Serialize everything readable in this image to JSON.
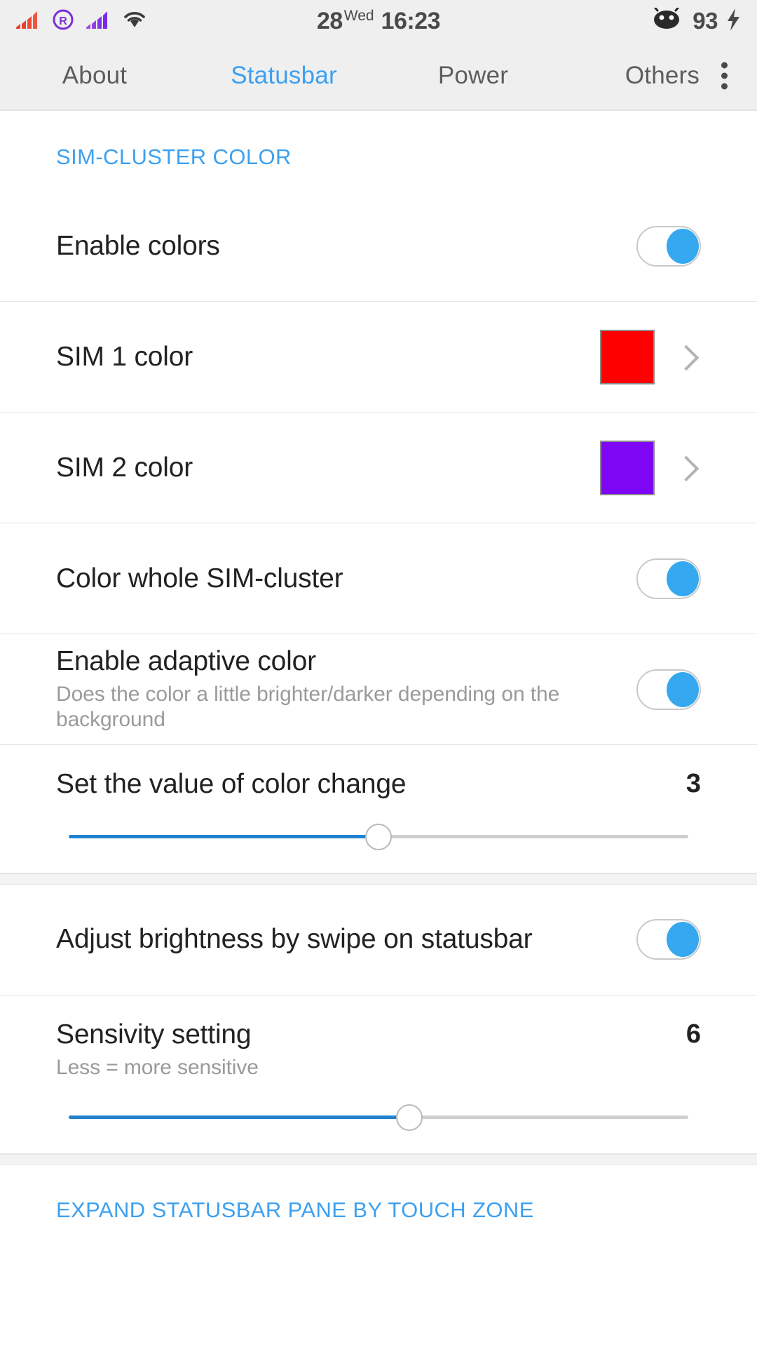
{
  "statusbar": {
    "icons": [
      "signal-bars-red-icon",
      "roaming-r-icon",
      "signal-bars-purple-icon",
      "wifi-icon"
    ],
    "date": "28",
    "day_of_week": "Wed",
    "time": "16:23",
    "android_head_icon": "android-head-icon",
    "battery_level": "93",
    "charging_icon": "charging-bolt-icon",
    "bg_color": "#efefef"
  },
  "tabs": [
    {
      "label": "About",
      "active": false
    },
    {
      "label": "Statusbar",
      "active": true
    },
    {
      "label": "Power",
      "active": false
    },
    {
      "label": "Others",
      "active": false
    }
  ],
  "overflow_menu_icon": "overflow-menu-icon",
  "accent_color": "#3da0f0",
  "sections": [
    {
      "header": "SIM-CLUSTER COLOR",
      "rows": [
        {
          "type": "toggle",
          "title": "Enable colors",
          "subtitle": "",
          "value": "on"
        },
        {
          "type": "color",
          "title": "SIM 1 color",
          "subtitle": "",
          "color": "#ff0000",
          "chevron": "chevron-right-icon"
        },
        {
          "type": "color",
          "title": "SIM 2 color",
          "subtitle": "",
          "color": "#7f06f5",
          "chevron": "chevron-right-icon"
        },
        {
          "type": "toggle",
          "title": "Color whole SIM-cluster",
          "subtitle": "",
          "value": "on"
        },
        {
          "type": "toggle",
          "title": "Enable adaptive color",
          "subtitle": "Does the color a little brighter/darker depending on the background",
          "value": "on"
        },
        {
          "type": "slider",
          "title": "Set the value of color change",
          "subtitle": "",
          "value": "3",
          "percent": 50
        }
      ]
    },
    {
      "header": "",
      "rows": [
        {
          "type": "toggle",
          "title": "Adjust brightness by swipe on statusbar",
          "subtitle": "",
          "value": "on"
        },
        {
          "type": "slider",
          "title": "Sensivity setting",
          "subtitle": "Less = more sensitive",
          "value": "6",
          "percent": 55
        }
      ]
    }
  ],
  "bottom_section_header": "EXPAND STATUSBAR PANE BY TOUCH ZONE"
}
